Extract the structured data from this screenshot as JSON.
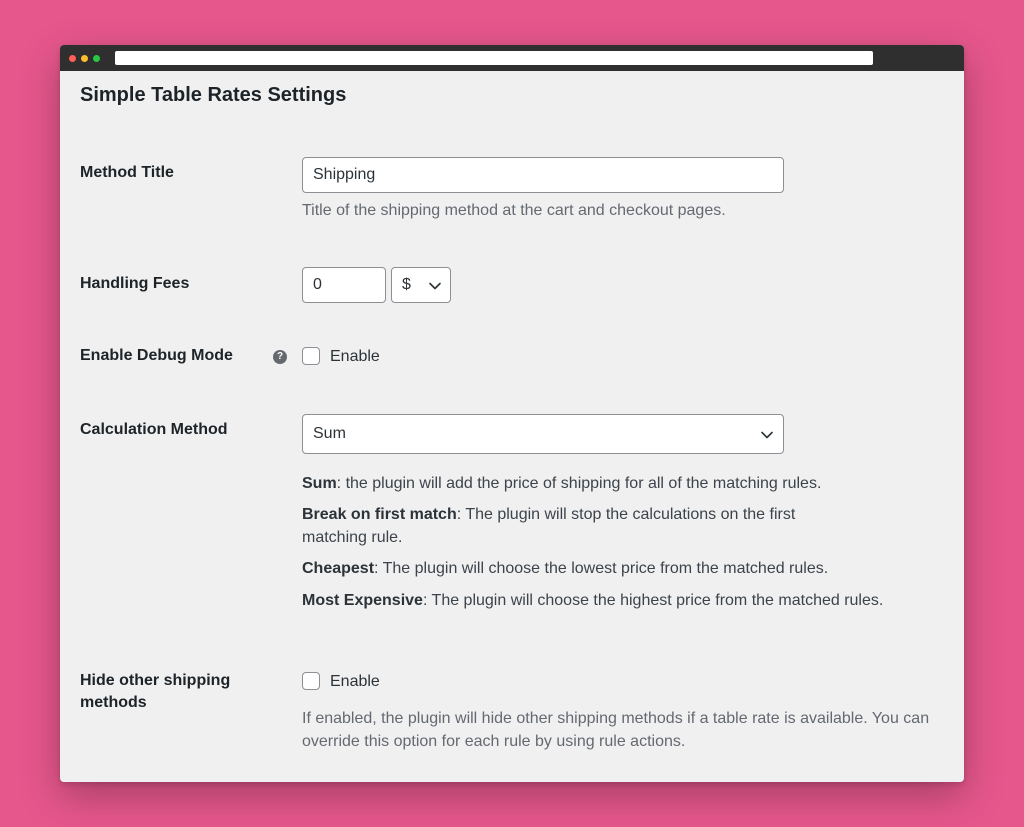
{
  "page_title": "Simple Table Rates Settings",
  "method_title": {
    "label": "Method Title",
    "value": "Shipping",
    "description": "Title of the shipping method at the cart and checkout pages."
  },
  "handling_fees": {
    "label": "Handling Fees",
    "value": "0",
    "currency": "$"
  },
  "debug_mode": {
    "label": "Enable Debug Mode",
    "help_icon": "?",
    "checkbox_label": "Enable",
    "checked": false
  },
  "calculation_method": {
    "label": "Calculation Method",
    "selected": "Sum",
    "options": [
      {
        "name": "Sum",
        "text": ": the plugin will add the price of shipping for all of the matching rules."
      },
      {
        "name": "Break on first match",
        "text": ": The plugin will stop the calculations on the first matching rule."
      },
      {
        "name": "Cheapest",
        "text": ": The plugin will choose the lowest price from the matched rules."
      },
      {
        "name": "Most Expensive",
        "text": ": The plugin will choose the highest price from the matched rules."
      }
    ]
  },
  "hide_other_methods": {
    "label": "Hide other shipping methods",
    "checkbox_label": "Enable",
    "checked": false,
    "description": "If enabled, the plugin will hide other shipping methods if a table rate is available. You can override this option for each rule by using rule actions."
  },
  "colors": {
    "background": "#e6578c",
    "panel": "#f0f0f1",
    "titlebar": "#2f2f2f"
  }
}
